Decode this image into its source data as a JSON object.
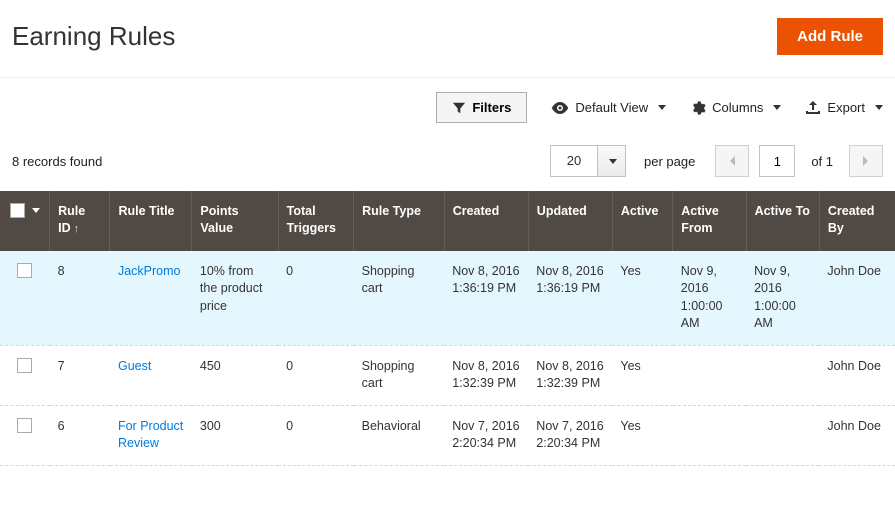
{
  "header": {
    "title": "Earning Rules",
    "add_button_label": "Add Rule"
  },
  "toolbar": {
    "filters_label": "Filters",
    "default_view_label": "Default View",
    "columns_label": "Columns",
    "export_label": "Export"
  },
  "controls": {
    "records_found_label": "8 records found",
    "page_size": "20",
    "per_page_label": "per page",
    "current_page": "1",
    "of_pages_label": "of 1"
  },
  "table": {
    "columns": [
      "Rule ID",
      "Rule Title",
      "Points Value",
      "Total Triggers",
      "Rule Type",
      "Created",
      "Updated",
      "Active",
      "Active From",
      "Active To",
      "Created By"
    ],
    "rows": [
      {
        "id": "8",
        "title": "JackPromo",
        "points": "10% from the product price",
        "triggers": "0",
        "type": "Shopping cart",
        "created": "Nov 8, 2016 1:36:19 PM",
        "updated": "Nov 8, 2016 1:36:19 PM",
        "active": "Yes",
        "active_from": "Nov 9, 2016 1:00:00 AM",
        "active_to": "Nov 9, 2016 1:00:00 AM",
        "created_by": "John Doe",
        "highlight": true
      },
      {
        "id": "7",
        "title": "Guest",
        "points": "450",
        "triggers": "0",
        "type": "Shopping cart",
        "created": "Nov 8, 2016 1:32:39 PM",
        "updated": "Nov 8, 2016 1:32:39 PM",
        "active": "Yes",
        "active_from": "",
        "active_to": "",
        "created_by": "John Doe"
      },
      {
        "id": "6",
        "title": "For Product Review",
        "points": "300",
        "triggers": "0",
        "type": "Behavioral",
        "created": "Nov 7, 2016 2:20:34 PM",
        "updated": "Nov 7, 2016 2:20:34 PM",
        "active": "Yes",
        "active_from": "",
        "active_to": "",
        "created_by": "John Doe"
      }
    ]
  }
}
